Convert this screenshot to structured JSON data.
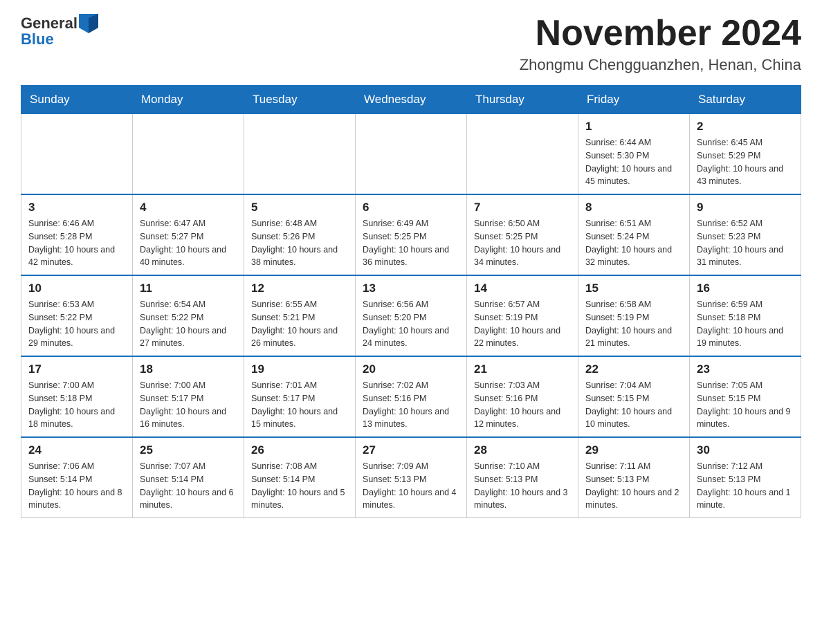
{
  "header": {
    "logo": {
      "general": "General",
      "blue": "Blue"
    },
    "title": "November 2024",
    "location": "Zhongmu Chengguanzhen, Henan, China"
  },
  "calendar": {
    "days_of_week": [
      "Sunday",
      "Monday",
      "Tuesday",
      "Wednesday",
      "Thursday",
      "Friday",
      "Saturday"
    ],
    "weeks": [
      [
        {
          "day": "",
          "sunrise": "",
          "sunset": "",
          "daylight": ""
        },
        {
          "day": "",
          "sunrise": "",
          "sunset": "",
          "daylight": ""
        },
        {
          "day": "",
          "sunrise": "",
          "sunset": "",
          "daylight": ""
        },
        {
          "day": "",
          "sunrise": "",
          "sunset": "",
          "daylight": ""
        },
        {
          "day": "",
          "sunrise": "",
          "sunset": "",
          "daylight": ""
        },
        {
          "day": "1",
          "sunrise": "Sunrise: 6:44 AM",
          "sunset": "Sunset: 5:30 PM",
          "daylight": "Daylight: 10 hours and 45 minutes."
        },
        {
          "day": "2",
          "sunrise": "Sunrise: 6:45 AM",
          "sunset": "Sunset: 5:29 PM",
          "daylight": "Daylight: 10 hours and 43 minutes."
        }
      ],
      [
        {
          "day": "3",
          "sunrise": "Sunrise: 6:46 AM",
          "sunset": "Sunset: 5:28 PM",
          "daylight": "Daylight: 10 hours and 42 minutes."
        },
        {
          "day": "4",
          "sunrise": "Sunrise: 6:47 AM",
          "sunset": "Sunset: 5:27 PM",
          "daylight": "Daylight: 10 hours and 40 minutes."
        },
        {
          "day": "5",
          "sunrise": "Sunrise: 6:48 AM",
          "sunset": "Sunset: 5:26 PM",
          "daylight": "Daylight: 10 hours and 38 minutes."
        },
        {
          "day": "6",
          "sunrise": "Sunrise: 6:49 AM",
          "sunset": "Sunset: 5:25 PM",
          "daylight": "Daylight: 10 hours and 36 minutes."
        },
        {
          "day": "7",
          "sunrise": "Sunrise: 6:50 AM",
          "sunset": "Sunset: 5:25 PM",
          "daylight": "Daylight: 10 hours and 34 minutes."
        },
        {
          "day": "8",
          "sunrise": "Sunrise: 6:51 AM",
          "sunset": "Sunset: 5:24 PM",
          "daylight": "Daylight: 10 hours and 32 minutes."
        },
        {
          "day": "9",
          "sunrise": "Sunrise: 6:52 AM",
          "sunset": "Sunset: 5:23 PM",
          "daylight": "Daylight: 10 hours and 31 minutes."
        }
      ],
      [
        {
          "day": "10",
          "sunrise": "Sunrise: 6:53 AM",
          "sunset": "Sunset: 5:22 PM",
          "daylight": "Daylight: 10 hours and 29 minutes."
        },
        {
          "day": "11",
          "sunrise": "Sunrise: 6:54 AM",
          "sunset": "Sunset: 5:22 PM",
          "daylight": "Daylight: 10 hours and 27 minutes."
        },
        {
          "day": "12",
          "sunrise": "Sunrise: 6:55 AM",
          "sunset": "Sunset: 5:21 PM",
          "daylight": "Daylight: 10 hours and 26 minutes."
        },
        {
          "day": "13",
          "sunrise": "Sunrise: 6:56 AM",
          "sunset": "Sunset: 5:20 PM",
          "daylight": "Daylight: 10 hours and 24 minutes."
        },
        {
          "day": "14",
          "sunrise": "Sunrise: 6:57 AM",
          "sunset": "Sunset: 5:19 PM",
          "daylight": "Daylight: 10 hours and 22 minutes."
        },
        {
          "day": "15",
          "sunrise": "Sunrise: 6:58 AM",
          "sunset": "Sunset: 5:19 PM",
          "daylight": "Daylight: 10 hours and 21 minutes."
        },
        {
          "day": "16",
          "sunrise": "Sunrise: 6:59 AM",
          "sunset": "Sunset: 5:18 PM",
          "daylight": "Daylight: 10 hours and 19 minutes."
        }
      ],
      [
        {
          "day": "17",
          "sunrise": "Sunrise: 7:00 AM",
          "sunset": "Sunset: 5:18 PM",
          "daylight": "Daylight: 10 hours and 18 minutes."
        },
        {
          "day": "18",
          "sunrise": "Sunrise: 7:00 AM",
          "sunset": "Sunset: 5:17 PM",
          "daylight": "Daylight: 10 hours and 16 minutes."
        },
        {
          "day": "19",
          "sunrise": "Sunrise: 7:01 AM",
          "sunset": "Sunset: 5:17 PM",
          "daylight": "Daylight: 10 hours and 15 minutes."
        },
        {
          "day": "20",
          "sunrise": "Sunrise: 7:02 AM",
          "sunset": "Sunset: 5:16 PM",
          "daylight": "Daylight: 10 hours and 13 minutes."
        },
        {
          "day": "21",
          "sunrise": "Sunrise: 7:03 AM",
          "sunset": "Sunset: 5:16 PM",
          "daylight": "Daylight: 10 hours and 12 minutes."
        },
        {
          "day": "22",
          "sunrise": "Sunrise: 7:04 AM",
          "sunset": "Sunset: 5:15 PM",
          "daylight": "Daylight: 10 hours and 10 minutes."
        },
        {
          "day": "23",
          "sunrise": "Sunrise: 7:05 AM",
          "sunset": "Sunset: 5:15 PM",
          "daylight": "Daylight: 10 hours and 9 minutes."
        }
      ],
      [
        {
          "day": "24",
          "sunrise": "Sunrise: 7:06 AM",
          "sunset": "Sunset: 5:14 PM",
          "daylight": "Daylight: 10 hours and 8 minutes."
        },
        {
          "day": "25",
          "sunrise": "Sunrise: 7:07 AM",
          "sunset": "Sunset: 5:14 PM",
          "daylight": "Daylight: 10 hours and 6 minutes."
        },
        {
          "day": "26",
          "sunrise": "Sunrise: 7:08 AM",
          "sunset": "Sunset: 5:14 PM",
          "daylight": "Daylight: 10 hours and 5 minutes."
        },
        {
          "day": "27",
          "sunrise": "Sunrise: 7:09 AM",
          "sunset": "Sunset: 5:13 PM",
          "daylight": "Daylight: 10 hours and 4 minutes."
        },
        {
          "day": "28",
          "sunrise": "Sunrise: 7:10 AM",
          "sunset": "Sunset: 5:13 PM",
          "daylight": "Daylight: 10 hours and 3 minutes."
        },
        {
          "day": "29",
          "sunrise": "Sunrise: 7:11 AM",
          "sunset": "Sunset: 5:13 PM",
          "daylight": "Daylight: 10 hours and 2 minutes."
        },
        {
          "day": "30",
          "sunrise": "Sunrise: 7:12 AM",
          "sunset": "Sunset: 5:13 PM",
          "daylight": "Daylight: 10 hours and 1 minute."
        }
      ]
    ]
  }
}
